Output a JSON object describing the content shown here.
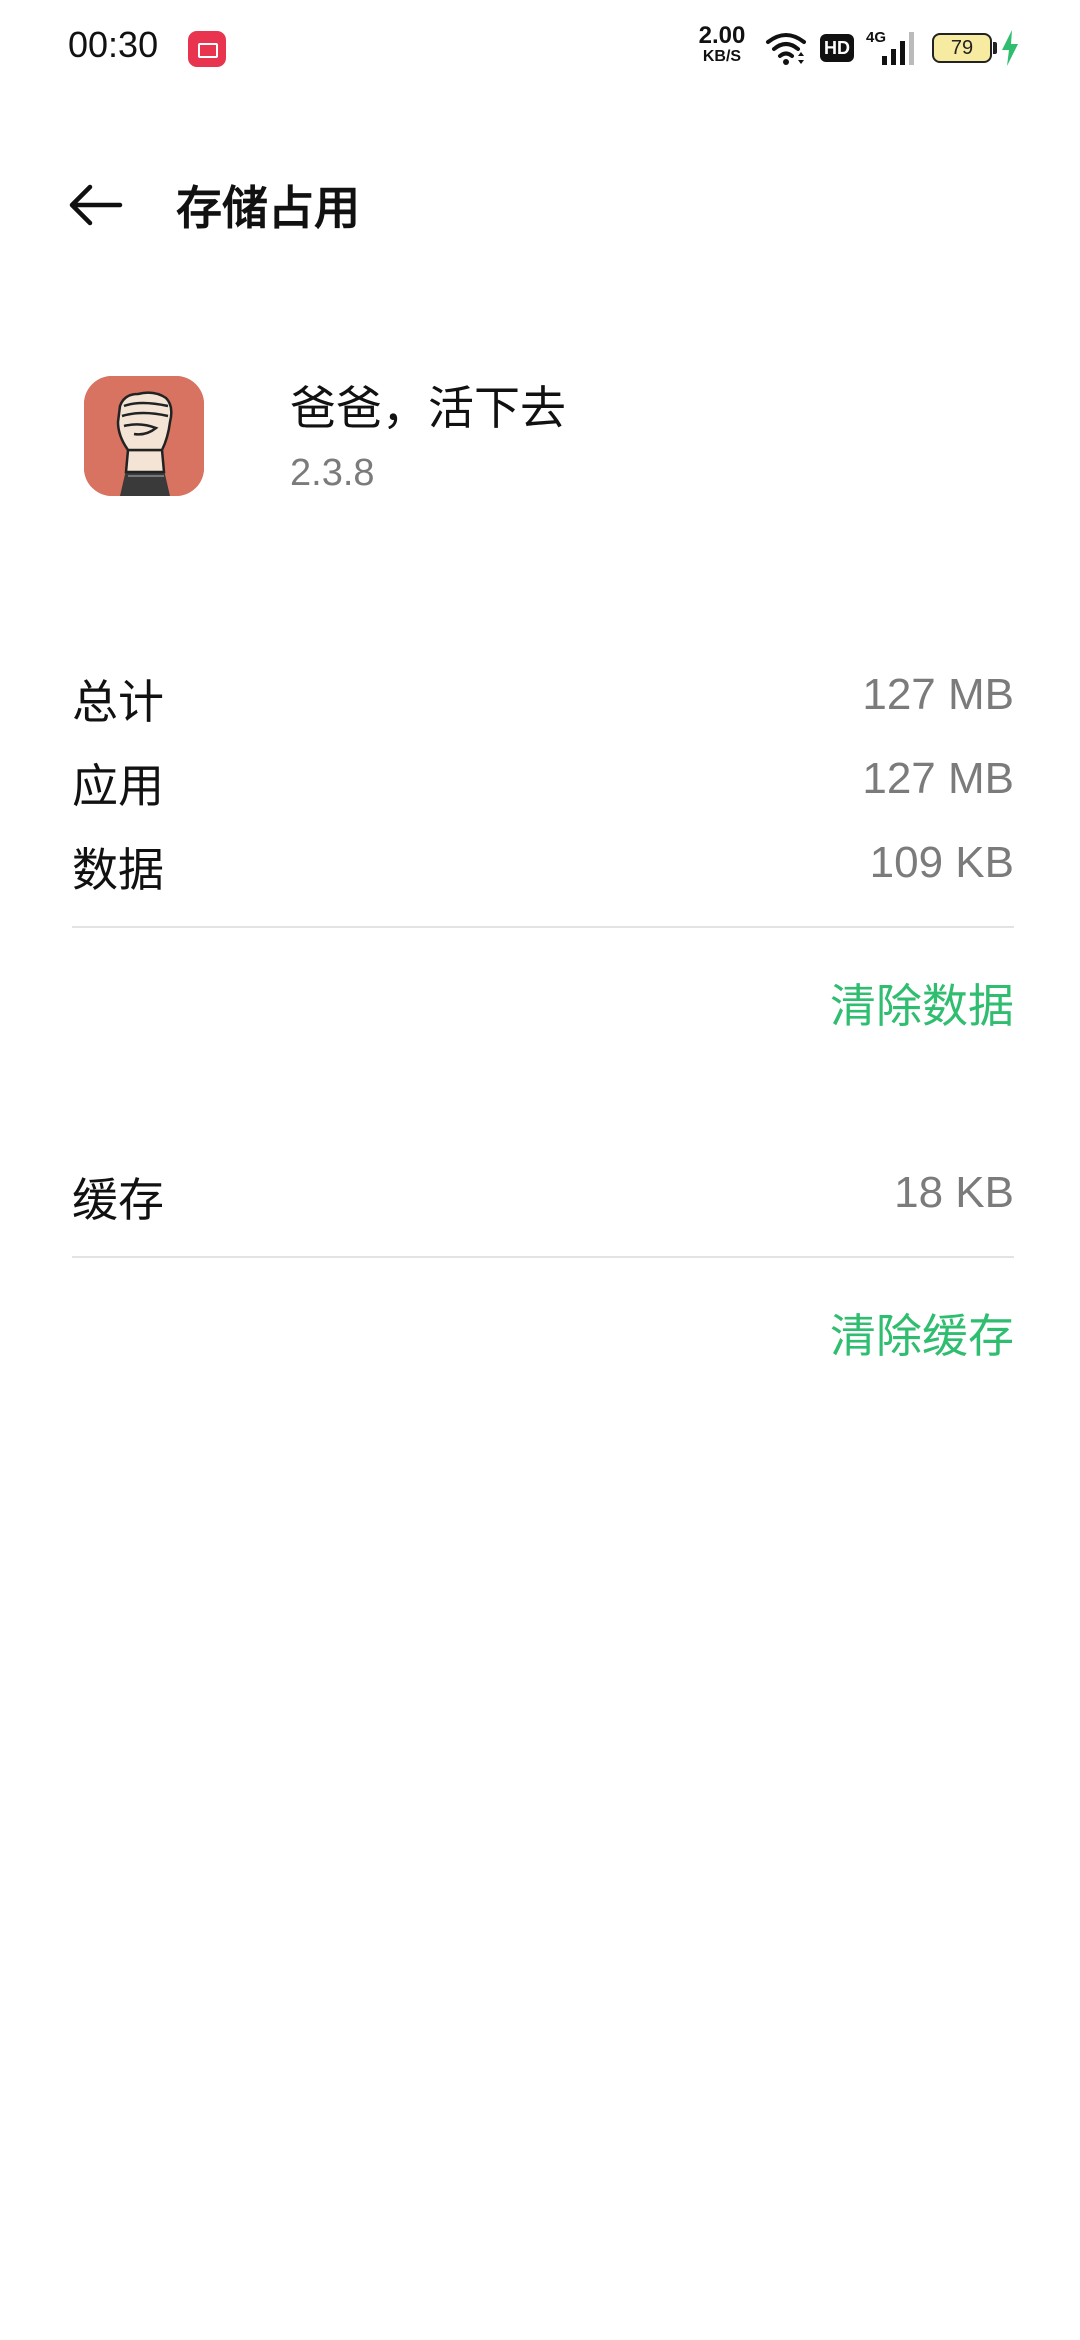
{
  "status_bar": {
    "time": "00:30",
    "net_speed_value": "2.00",
    "net_speed_unit": "KB/S",
    "hd_label": "HD",
    "network_type": "4G",
    "battery_level": "79",
    "icons": [
      "screen-record-icon",
      "wifi-icon",
      "hd-icon",
      "signal-icon",
      "battery-icon",
      "charging-icon"
    ]
  },
  "header": {
    "title": "存储占用",
    "back_icon": "back-arrow-icon"
  },
  "app": {
    "name": "爸爸，活下去",
    "version": "2.3.8",
    "icon_bg_color": "#d77360"
  },
  "storage": {
    "rows": [
      {
        "label": "总计",
        "value": "127 MB"
      },
      {
        "label": "应用",
        "value": "127 MB"
      },
      {
        "label": "数据",
        "value": "109 KB"
      }
    ],
    "clear_data_label": "清除数据"
  },
  "cache": {
    "label": "缓存",
    "value": "18 KB",
    "clear_cache_label": "清除缓存"
  },
  "colors": {
    "accent": "#2fbd70",
    "secondary_text": "#7b7b7b",
    "record_badge": "#e8344e"
  }
}
